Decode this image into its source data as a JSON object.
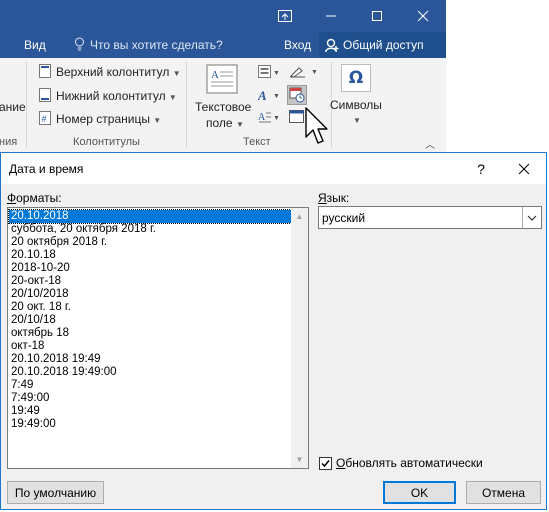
{
  "word": {
    "tabs": {
      "view": "Вид",
      "tell_me": "Что вы хотите сделать?",
      "sign_in": "Вход",
      "share": "Общий доступ"
    },
    "ribbon": {
      "left_partial_top": "ание",
      "left_partial_group": "ния",
      "header": "Верхний колонтитул",
      "footer": "Нижний колонтитул",
      "page_number": "Номер страницы",
      "group_headers": "Колонтитулы",
      "textbox_line1": "Текстовое",
      "textbox_line2": "поле",
      "group_text": "Текст",
      "symbols": "Символы"
    }
  },
  "dialog": {
    "title": "Дата и время",
    "help": "?",
    "formats_label": "Форматы:",
    "formats": [
      "20.10.2018",
      "суббота, 20 октября 2018 г.",
      "20 октября 2018 г.",
      "20.10.18",
      "2018-10-20",
      "20-окт-18",
      "20/10/2018",
      "20 окт. 18 г.",
      "20/10/18",
      "октябрь 18",
      "окт-18",
      "20.10.2018 19:49",
      "20.10.2018 19:49:00",
      "7:49",
      "7:49:00",
      "19:49",
      "19:49:00"
    ],
    "selected_format_index": 0,
    "language_label": "Язык:",
    "language_value": "русский",
    "auto_update_label": "Обновлять автоматически",
    "auto_update_checked": true,
    "default_button": "По умолчанию",
    "ok_button": "OK",
    "cancel_button": "Отмена"
  }
}
